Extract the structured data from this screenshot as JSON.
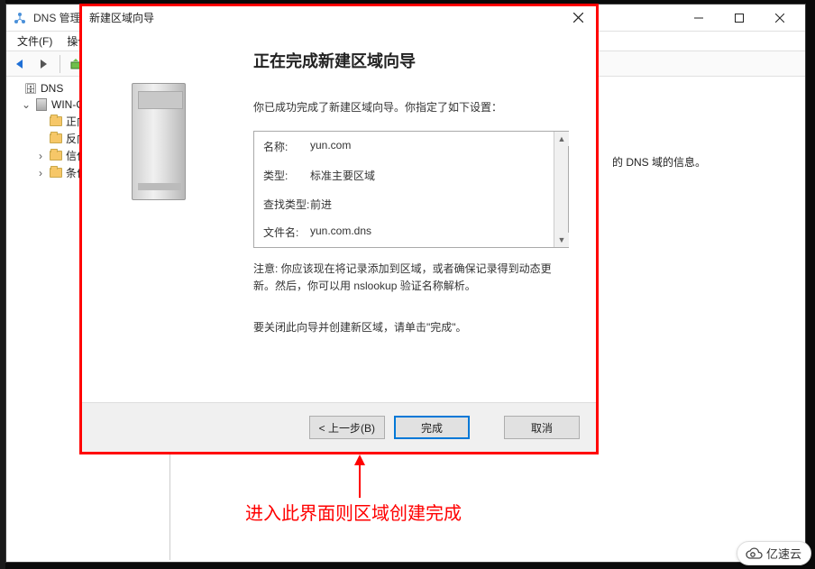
{
  "parent_window": {
    "title": "DNS 管理",
    "menu": {
      "file": "文件(F)",
      "action": "操作"
    },
    "tree": {
      "root": "DNS",
      "server": "WIN-O",
      "folders": {
        "forward": "正向",
        "reverse": "反向",
        "trust": "信任",
        "cond": "条件"
      }
    },
    "right_msg": "的 DNS 域的信息。"
  },
  "wizard": {
    "title": "新建区域向导",
    "heading": "正在完成新建区域向导",
    "intro": "你已成功完成了新建区域向导。你指定了如下设置：",
    "summary": {
      "name_lbl": "名称:",
      "name_val": "yun.com",
      "type_lbl": "类型:",
      "type_val": "标准主要区域",
      "lookup_lbl": "查找类型:",
      "lookup_val": "前进",
      "file_lbl": "文件名:",
      "file_val": "yun.com.dns"
    },
    "note": "注意: 你应该现在将记录添加到区域，或者确保记录得到动态更新。然后，你可以用 nslookup 验证名称解析。",
    "close_hint": "要关闭此向导并创建新区域，请单击\"完成\"。",
    "buttons": {
      "back": "< 上一步(B)",
      "finish": "完成",
      "cancel": "取消"
    }
  },
  "annotation": "进入此界面则区域创建完成",
  "watermark": "亿速云"
}
